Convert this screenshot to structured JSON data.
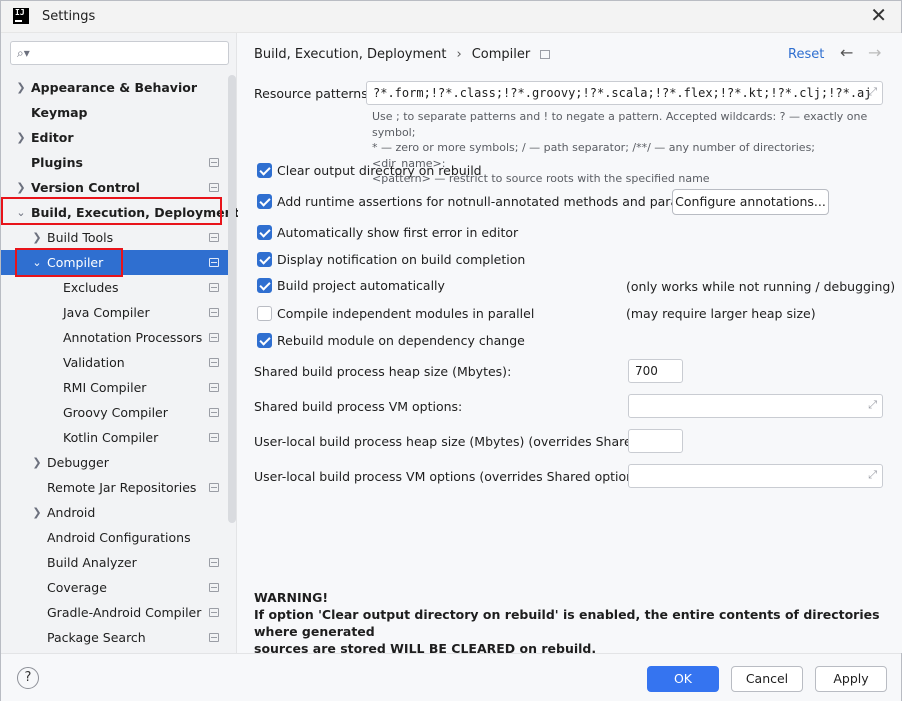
{
  "window": {
    "title": "Settings"
  },
  "search": {
    "placeholder": ""
  },
  "sidebar": {
    "items": [
      {
        "label": "Appearance & Behavior"
      },
      {
        "label": "Keymap"
      },
      {
        "label": "Editor"
      },
      {
        "label": "Plugins"
      },
      {
        "label": "Version Control"
      },
      {
        "label": "Build, Execution, Deployment"
      },
      {
        "label": "Build Tools"
      },
      {
        "label": "Compiler"
      },
      {
        "label": "Excludes"
      },
      {
        "label": "Java Compiler"
      },
      {
        "label": "Annotation Processors"
      },
      {
        "label": "Validation"
      },
      {
        "label": "RMI Compiler"
      },
      {
        "label": "Groovy Compiler"
      },
      {
        "label": "Kotlin Compiler"
      },
      {
        "label": "Debugger"
      },
      {
        "label": "Remote Jar Repositories"
      },
      {
        "label": "Android"
      },
      {
        "label": "Android Configurations"
      },
      {
        "label": "Build Analyzer"
      },
      {
        "label": "Coverage"
      },
      {
        "label": "Gradle-Android Compiler"
      },
      {
        "label": "Package Search"
      }
    ]
  },
  "header": {
    "breadcrumb_parent": "Build, Execution, Deployment",
    "breadcrumb_current": "Compiler",
    "reset_label": "Reset"
  },
  "form": {
    "resource_patterns_label": "Resource patterns:",
    "resource_patterns_value": "?*.form;!?*.class;!?*.groovy;!?*.scala;!?*.flex;!?*.kt;!?*.clj;!?*.aj",
    "hint_line1": "Use ; to separate patterns and ! to negate a pattern. Accepted wildcards: ? — exactly one symbol;",
    "hint_line2": "* — zero or more symbols; / — path separator; /**/ — any number of directories; <dir_name>:",
    "hint_line3": "<pattern> — restrict to source roots with the specified name",
    "clear_output_label": "Clear output directory on rebuild",
    "runtime_assertions_label": "Add runtime assertions for notnull-annotated methods and parameters",
    "configure_annotations_label": "Configure annotations...",
    "show_first_error_label": "Automatically show first error in editor",
    "display_notification_label": "Display notification on build completion",
    "build_automatically_label": "Build project automatically",
    "build_automatically_note": "(only works while not running / debugging)",
    "compile_parallel_label": "Compile independent modules in parallel",
    "compile_parallel_note": "(may require larger heap size)",
    "rebuild_module_label": "Rebuild module on dependency change",
    "heap_size_label": "Shared build process heap size (Mbytes):",
    "heap_size_value": "700",
    "vm_options_label": "Shared build process VM options:",
    "vm_options_value": "",
    "local_heap_label": "User-local build process heap size (Mbytes) (overrides Shared size):",
    "local_heap_value": "",
    "local_vm_label": "User-local build process VM options (overrides Shared options):",
    "local_vm_value": ""
  },
  "warning": {
    "title": "WARNING!",
    "line1": "If option 'Clear output directory on rebuild' is enabled, the entire contents of directories where generated",
    "line2": "sources are stored WILL BE CLEARED on rebuild."
  },
  "footer": {
    "help_label": "?",
    "ok_label": "OK",
    "cancel_label": "Cancel",
    "apply_label": "Apply"
  },
  "colors": {
    "accent": "#2f6fd0",
    "highlight": "#e8131a",
    "primary_button": "#3574f0"
  },
  "icons": [
    "app-logo-icon",
    "close-icon",
    "search-icon",
    "chevron-right-icon",
    "chevron-down-icon",
    "settings-scope-icon",
    "back-arrow-icon",
    "forward-arrow-icon",
    "expand-icon",
    "help-icon"
  ]
}
